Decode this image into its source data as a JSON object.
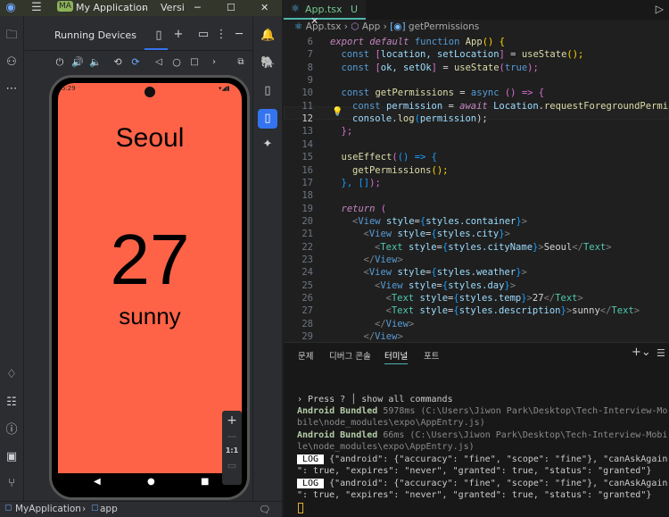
{
  "android_studio": {
    "title": {
      "initials": "MA",
      "project": "My Application",
      "version_label": "Versi"
    },
    "panel": {
      "title": "Running Devices"
    },
    "device": {
      "status_time": "5:29",
      "city": "Seoul",
      "temp": "27",
      "description": "sunny",
      "screen_color": "#ff6347"
    },
    "zoom": {
      "plus": "+",
      "minus": "—",
      "actual": "1:1"
    },
    "footer": {
      "project": "MyApplication",
      "module": "app"
    }
  },
  "vscode": {
    "tab": {
      "name": "App.tsx",
      "status": "U"
    },
    "breadcrumb": [
      "App.tsx",
      "App",
      "getPermissions"
    ],
    "code_lines": [
      {
        "n": "6",
        "indent": 0,
        "tokens": [
          [
            "export default ",
            "c"
          ],
          [
            "function ",
            "k"
          ],
          [
            "App",
            "f"
          ],
          [
            "() ",
            "b"
          ],
          [
            "{",
            "b"
          ]
        ]
      },
      {
        "n": "7",
        "indent": 1,
        "tokens": [
          [
            "const ",
            "k"
          ],
          [
            "[",
            "b2"
          ],
          [
            "location, setLocation",
            "v"
          ],
          [
            "]",
            "b2"
          ],
          [
            " = ",
            "p"
          ],
          [
            "useState",
            "f"
          ],
          [
            "();",
            "b"
          ]
        ]
      },
      {
        "n": "8",
        "indent": 1,
        "tokens": [
          [
            "const ",
            "k"
          ],
          [
            "[",
            "b2"
          ],
          [
            "ok, setOk",
            "v"
          ],
          [
            "]",
            "b2"
          ],
          [
            " = ",
            "p"
          ],
          [
            "useState",
            "f"
          ],
          [
            "(",
            "b2"
          ],
          [
            "true",
            "k"
          ],
          [
            ");",
            "b2"
          ]
        ]
      },
      {
        "n": "9",
        "indent": 0,
        "tokens": []
      },
      {
        "n": "10",
        "indent": 1,
        "tokens": [
          [
            "const ",
            "k"
          ],
          [
            "getPermissions",
            "f"
          ],
          [
            " = ",
            "p"
          ],
          [
            "async ",
            "k"
          ],
          [
            "() => ",
            "b2"
          ],
          [
            "{",
            "b2"
          ]
        ]
      },
      {
        "n": "11",
        "indent": 2,
        "tokens": [
          [
            "const ",
            "k"
          ],
          [
            "permission",
            "v"
          ],
          [
            " = ",
            "p"
          ],
          [
            "await ",
            "c"
          ],
          [
            "Location",
            "v"
          ],
          [
            ".",
            "p"
          ],
          [
            "requestForegroundPermissio",
            "f"
          ]
        ]
      },
      {
        "n": "12",
        "indent": 2,
        "tokens": [
          [
            "console",
            "v"
          ],
          [
            ".",
            "p"
          ],
          [
            "log",
            "f"
          ],
          [
            "(",
            "b3"
          ],
          [
            "permission",
            "v"
          ],
          [
            ");",
            "p"
          ]
        ]
      },
      {
        "n": "13",
        "indent": 1,
        "tokens": [
          [
            "};",
            "b2"
          ]
        ]
      },
      {
        "n": "14",
        "indent": 0,
        "tokens": []
      },
      {
        "n": "15",
        "indent": 1,
        "tokens": [
          [
            "useEffect",
            "f"
          ],
          [
            "(",
            "b2"
          ],
          [
            "() => ",
            "b3"
          ],
          [
            "{",
            "b3"
          ]
        ]
      },
      {
        "n": "16",
        "indent": 2,
        "tokens": [
          [
            "getPermissions",
            "f"
          ],
          [
            "();",
            "b"
          ]
        ]
      },
      {
        "n": "17",
        "indent": 1,
        "tokens": [
          [
            "}, ",
            "b3"
          ],
          [
            "[]",
            "b3"
          ],
          [
            ");",
            "b2"
          ]
        ]
      },
      {
        "n": "18",
        "indent": 0,
        "tokens": []
      },
      {
        "n": "19",
        "indent": 1,
        "tokens": [
          [
            "return ",
            "c"
          ],
          [
            "(",
            "b2"
          ]
        ]
      },
      {
        "n": "20",
        "indent": 2,
        "tokens": [
          [
            "<",
            "tg"
          ],
          [
            "View ",
            "k"
          ],
          [
            "style",
            "v"
          ],
          [
            "=",
            "p"
          ],
          [
            "{",
            "b3"
          ],
          [
            "styles.container",
            "v"
          ],
          [
            "}",
            "b3"
          ],
          [
            ">",
            "tg"
          ]
        ]
      },
      {
        "n": "21",
        "indent": 3,
        "tokens": [
          [
            "<",
            "tg"
          ],
          [
            "View ",
            "k"
          ],
          [
            "style",
            "v"
          ],
          [
            "=",
            "p"
          ],
          [
            "{",
            "b3"
          ],
          [
            "styles.city",
            "v"
          ],
          [
            "}",
            "b3"
          ],
          [
            ">",
            "tg"
          ]
        ]
      },
      {
        "n": "22",
        "indent": 4,
        "tokens": [
          [
            "<",
            "tg"
          ],
          [
            "Text ",
            "t"
          ],
          [
            "style",
            "v"
          ],
          [
            "=",
            "p"
          ],
          [
            "{",
            "b3"
          ],
          [
            "styles.cityName",
            "v"
          ],
          [
            "}",
            "b3"
          ],
          [
            ">",
            "tg"
          ],
          [
            "Seoul",
            "p"
          ],
          [
            "</",
            "tg"
          ],
          [
            "Text",
            "t"
          ],
          [
            ">",
            "tg"
          ]
        ]
      },
      {
        "n": "23",
        "indent": 3,
        "tokens": [
          [
            "</",
            "tg"
          ],
          [
            "View",
            "k"
          ],
          [
            ">",
            "tg"
          ]
        ]
      },
      {
        "n": "24",
        "indent": 3,
        "tokens": [
          [
            "<",
            "tg"
          ],
          [
            "View ",
            "k"
          ],
          [
            "style",
            "v"
          ],
          [
            "=",
            "p"
          ],
          [
            "{",
            "b3"
          ],
          [
            "styles.weather",
            "v"
          ],
          [
            "}",
            "b3"
          ],
          [
            ">",
            "tg"
          ]
        ]
      },
      {
        "n": "25",
        "indent": 4,
        "tokens": [
          [
            "<",
            "tg"
          ],
          [
            "View ",
            "k"
          ],
          [
            "style",
            "v"
          ],
          [
            "=",
            "p"
          ],
          [
            "{",
            "b3"
          ],
          [
            "styles.day",
            "v"
          ],
          [
            "}",
            "b3"
          ],
          [
            ">",
            "tg"
          ]
        ]
      },
      {
        "n": "26",
        "indent": 5,
        "tokens": [
          [
            "<",
            "tg"
          ],
          [
            "Text ",
            "t"
          ],
          [
            "style",
            "v"
          ],
          [
            "=",
            "p"
          ],
          [
            "{",
            "b3"
          ],
          [
            "styles.temp",
            "v"
          ],
          [
            "}",
            "b3"
          ],
          [
            ">",
            "tg"
          ],
          [
            "27",
            "p"
          ],
          [
            "</",
            "tg"
          ],
          [
            "Text",
            "t"
          ],
          [
            ">",
            "tg"
          ]
        ]
      },
      {
        "n": "27",
        "indent": 5,
        "tokens": [
          [
            "<",
            "tg"
          ],
          [
            "Text ",
            "t"
          ],
          [
            "style",
            "v"
          ],
          [
            "=",
            "p"
          ],
          [
            "{",
            "b3"
          ],
          [
            "styles.description",
            "v"
          ],
          [
            "}",
            "b3"
          ],
          [
            ">",
            "tg"
          ],
          [
            "sunny",
            "p"
          ],
          [
            "</",
            "tg"
          ],
          [
            "Text",
            "t"
          ],
          [
            ">",
            "tg"
          ]
        ]
      },
      {
        "n": "28",
        "indent": 4,
        "tokens": [
          [
            "</",
            "tg"
          ],
          [
            "View",
            "k"
          ],
          [
            ">",
            "tg"
          ]
        ]
      },
      {
        "n": "29",
        "indent": 3,
        "tokens": [
          [
            "</",
            "tg"
          ],
          [
            "View",
            "k"
          ],
          [
            ">",
            "tg"
          ]
        ]
      }
    ],
    "panel_tabs": [
      "문제",
      "디버그 콘솔",
      "터미널",
      "포트"
    ],
    "terminal": {
      "prompt": "› Press ? │ show all commands",
      "bundles": [
        {
          "label": "Android Bundled",
          "rest": " 5978ms (C:\\Users\\Jiwon Park\\Desktop\\Tech-Interview-Mo",
          "cont": "bile\\node_modules\\expo\\AppEntry.js)"
        },
        {
          "label": "Android Bundled",
          "rest": " 66ms (C:\\Users\\Jiwon Park\\Desktop\\Tech-Interview-Mobi",
          "cont": "le\\node_modules\\expo\\AppEntry.js)"
        }
      ],
      "logs": [
        {
          "badge": "LOG",
          "line1": " {\"android\": {\"accuracy\": \"fine\", \"scope\": \"fine\"}, \"canAskAgain",
          "line2": "\": true, \"expires\": \"never\", \"granted\": true, \"status\": \"granted\"}"
        },
        {
          "badge": "LOG",
          "line1": " {\"android\": {\"accuracy\": \"fine\", \"scope\": \"fine\"}, \"canAskAgain",
          "line2": "\": true, \"expires\": \"never\", \"granted\": true, \"status\": \"granted\"}"
        }
      ]
    }
  }
}
